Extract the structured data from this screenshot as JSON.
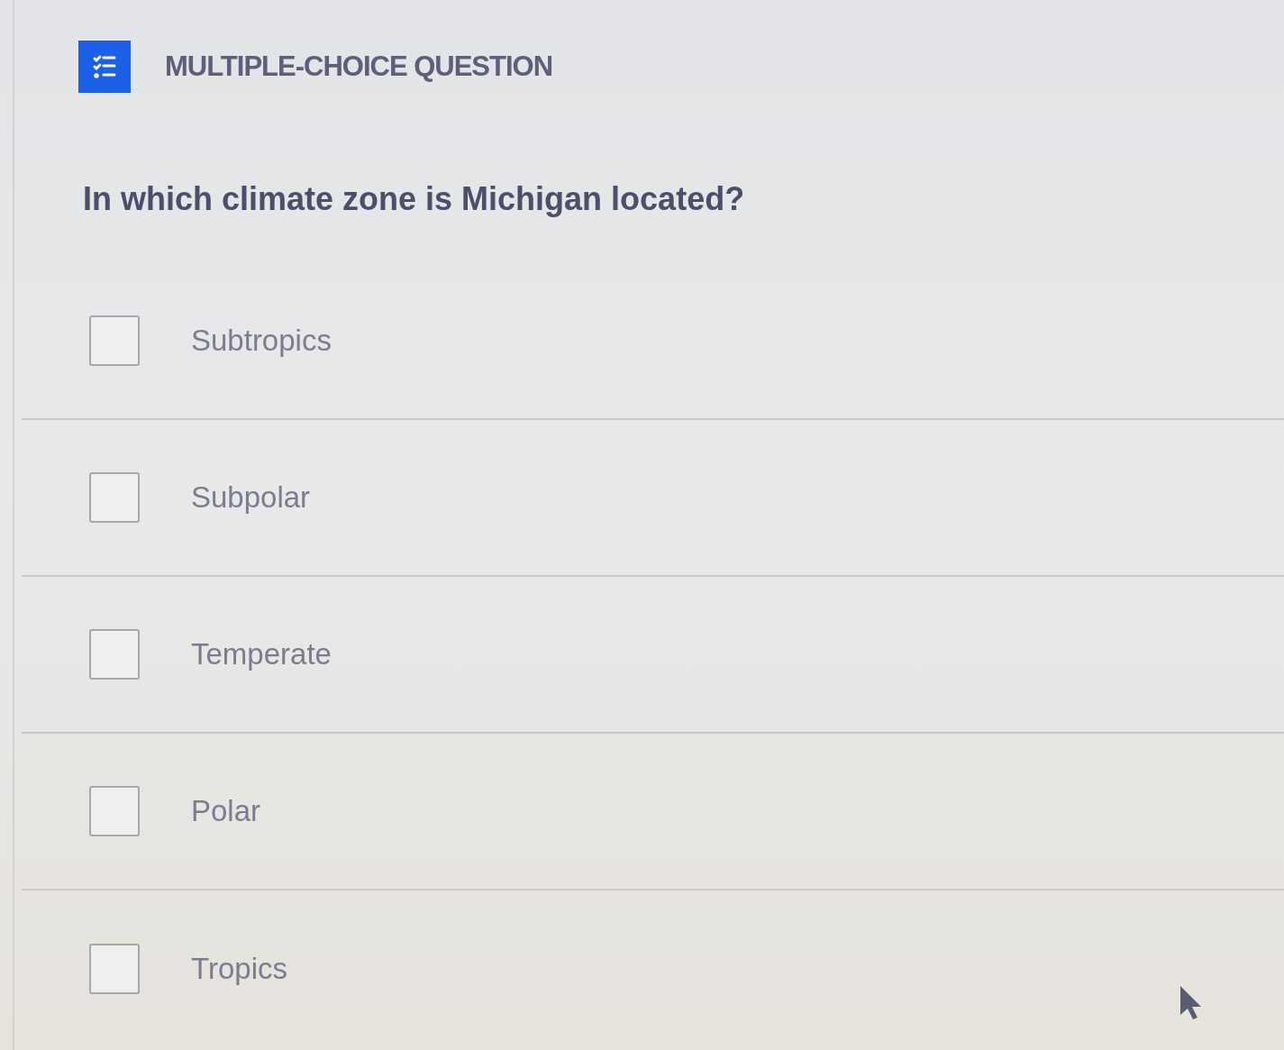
{
  "header": {
    "title": "MULTIPLE-CHOICE QUESTION"
  },
  "question": {
    "text": "In which climate zone is Michigan located?"
  },
  "options": [
    {
      "label": "Subtropics",
      "checked": false
    },
    {
      "label": "Subpolar",
      "checked": false
    },
    {
      "label": "Temperate",
      "checked": false
    },
    {
      "label": "Polar",
      "checked": false
    },
    {
      "label": "Tropics",
      "checked": false
    }
  ]
}
